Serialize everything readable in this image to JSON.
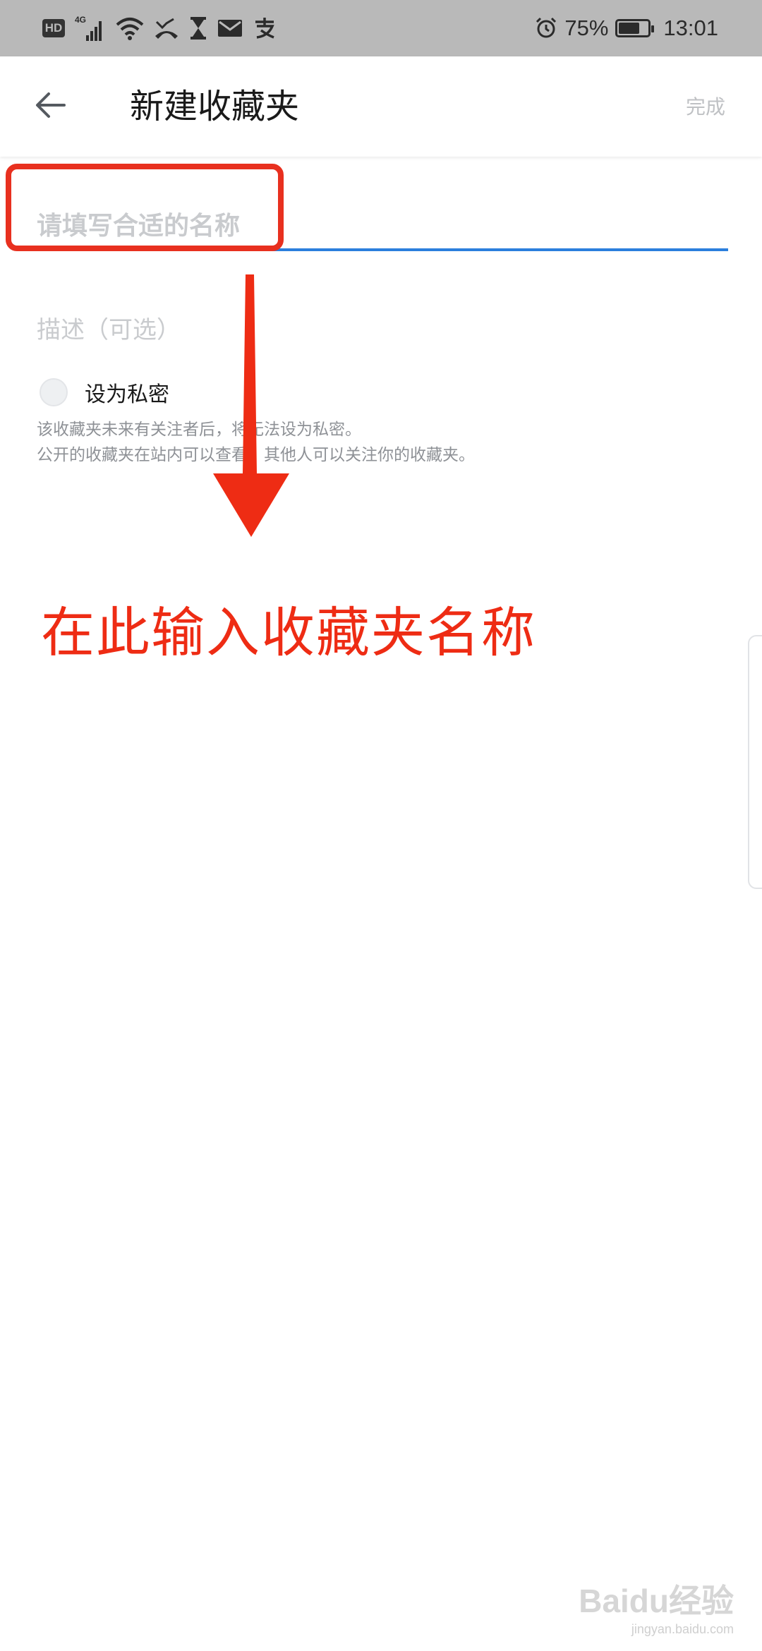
{
  "status_bar": {
    "hd_label": "HD",
    "network_label": "4G",
    "battery_percent": "75%",
    "battery_level": 0.75,
    "time": "13:01",
    "icons": [
      "hd-icon",
      "signal-4g-icon",
      "wifi-icon",
      "missed-call-icon",
      "hourglass-icon",
      "mail-icon",
      "alipay-icon",
      "alarm-icon",
      "battery-icon"
    ]
  },
  "header": {
    "back_icon": "arrow-left-icon",
    "title": "新建收藏夹",
    "done_label": "完成"
  },
  "form": {
    "name_placeholder": "请填写合适的名称",
    "name_value": "",
    "description_placeholder": "描述（可选）",
    "description_value": "",
    "private_label": "设为私密",
    "private_checked": false,
    "hint_line1": "该收藏夹未来有关注者后，将无法设为私密。",
    "hint_line2": "公开的收藏夹在站内可以查看，其他人可以关注你的收藏夹。"
  },
  "annotation": {
    "text": "在此输入收藏夹名称",
    "color": "#ee2c14"
  },
  "colors": {
    "status_bar_bg": "#b9b9b9",
    "accent": "#2b7fdd",
    "highlight": "#e8301f"
  },
  "watermark": {
    "logo_text": "Baidu经验",
    "url": "jingyan.baidu.com"
  }
}
